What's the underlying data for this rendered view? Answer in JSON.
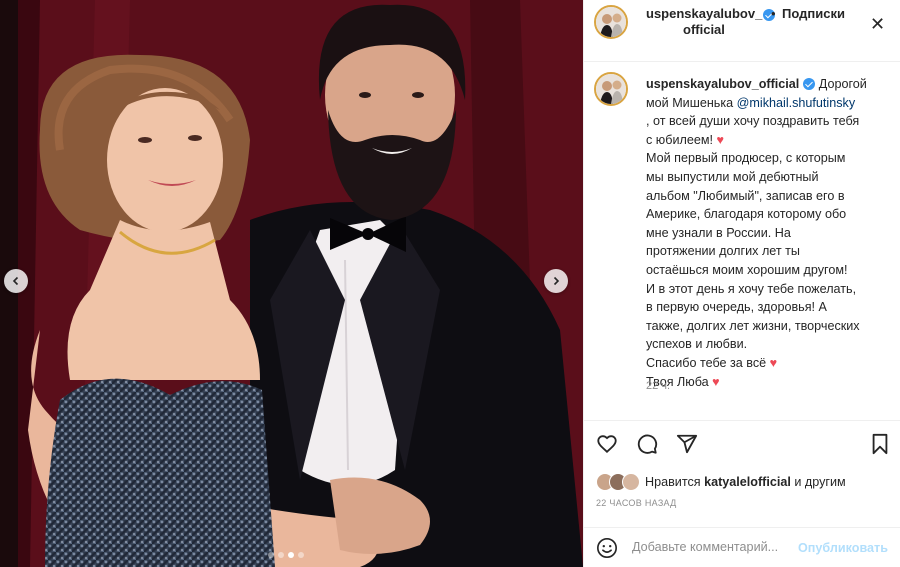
{
  "post": {
    "username": "uspenskayalubov_",
    "username_line2": "official",
    "caption_username": "uspenskayalubov_official",
    "header_separator": "•",
    "follow_label": "Подписки",
    "more_label": "✕",
    "caption": {
      "line1_tail": "Дорогой",
      "line2_head": "мой Мишенька",
      "mention": "@mikhail.shufutinsky",
      "line3": ", от всей души хочу поздравить тебя",
      "line4": "с юбилеем!",
      "line5": "Мой первый продюсер, с которым",
      "line6": "мы выпустили мой дебютный",
      "line7": "альбом \"Любимый\", записав его в",
      "line8": "Америке, благодаря которому обо",
      "line9": "мне узнали в России. На",
      "line10": "протяжении долгих лет ты",
      "line11": "остаёшься моим хорошим другом!",
      "line12": "И в этот день я хочу тебе пожелать,",
      "line13": "в первую очередь, здоровья! А",
      "line14": "также, долгих лет жизни, творческих",
      "line15": "успехов и любви.",
      "line16": "Спасибо тебе за всё",
      "line17": "Твоя Люба",
      "heart": "♥"
    },
    "time_posted": "22 ч.",
    "likes_prefix": "Нравится",
    "likes_user": "katyalelofficial",
    "likes_suffix": "и другим",
    "ago": "22 ЧАСОВ НАЗАД",
    "comment_placeholder": "Добавьте комментарий...",
    "publish_label": "Опубликовать",
    "carousel": {
      "total_slides": 4,
      "active_slide": 3
    }
  },
  "colors": {
    "accent_blue": "#3897f0",
    "publish_disabled": "#b2dffc",
    "heart_red": "#ed4956",
    "mention": "#00376b"
  },
  "icons": [
    "chevron-left-icon",
    "chevron-right-icon",
    "verified-icon",
    "heart-outline-icon",
    "comment-icon",
    "share-icon",
    "bookmark-icon",
    "emoji-icon"
  ]
}
